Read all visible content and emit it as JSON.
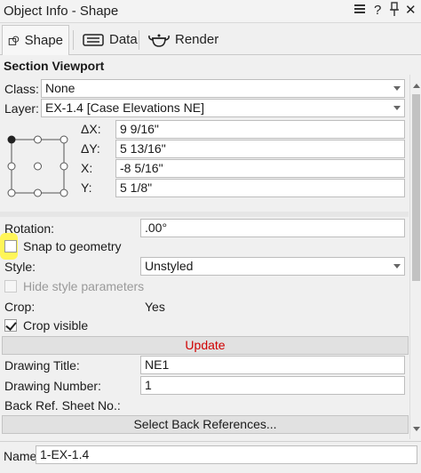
{
  "window": {
    "title": "Object Info - Shape",
    "menu_icon": "hamburger-icon",
    "help_label": "?",
    "pin_icon": "pin-icon",
    "close_label": "✕"
  },
  "tabs": [
    {
      "label": "Shape",
      "icon": "shape-icon",
      "active": true
    },
    {
      "label": "Data",
      "icon": "data-icon",
      "active": false
    },
    {
      "label": "Render",
      "icon": "teapot-icon",
      "active": false
    }
  ],
  "section_title": "Section Viewport",
  "class_field": {
    "label": "Class:",
    "value": "None"
  },
  "layer_field": {
    "label": "Layer:",
    "value": "EX-1.4 [Case Elevations NE]"
  },
  "position": {
    "dx": {
      "label": "ΔX:",
      "value": "9 9/16\""
    },
    "dy": {
      "label": "ΔY:",
      "value": "5 13/16\""
    },
    "x": {
      "label": "X:",
      "value": "-8 5/16\""
    },
    "y": {
      "label": "Y:",
      "value": "5 1/8\""
    }
  },
  "rotation": {
    "label": "Rotation:",
    "value": ".00°"
  },
  "snap_to_geometry": {
    "label": "Snap to geometry",
    "checked": false
  },
  "style": {
    "label": "Style:",
    "value": "Unstyled"
  },
  "hide_style_parameters": {
    "label": "Hide style parameters",
    "checked": false,
    "disabled": true
  },
  "crop": {
    "label": "Crop:",
    "value": "Yes"
  },
  "crop_visible": {
    "label": "Crop visible",
    "checked": true
  },
  "update_button": {
    "label": "Update",
    "color": "#d00000"
  },
  "drawing_title": {
    "label": "Drawing Title:",
    "value": "NE1"
  },
  "drawing_number": {
    "label": "Drawing Number:",
    "value": "1"
  },
  "back_ref_sheet": {
    "label": "Back Ref. Sheet No.:"
  },
  "select_back_refs": {
    "label": "Select Back References..."
  },
  "name_field": {
    "label": "Name:",
    "value": "1-EX-1.4"
  },
  "colors": {
    "highlight": "#fff44f",
    "update_text": "#d00000"
  }
}
